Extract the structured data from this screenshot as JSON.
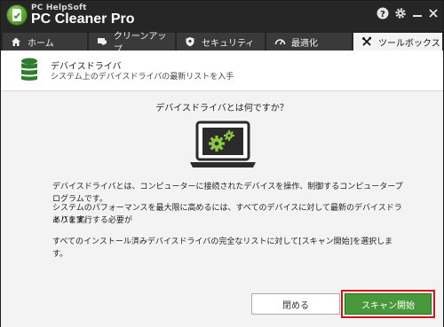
{
  "app": {
    "brand_small": "PC HelpSoft",
    "brand_big": "PC Cleaner Pro"
  },
  "titlebar_icons": [
    "help-icon",
    "gear-icon",
    "minimize-icon",
    "close-icon"
  ],
  "tabs": [
    {
      "label": "ホーム",
      "icon": "home-icon",
      "active": false
    },
    {
      "label": "クリーンアップ",
      "icon": "broom-icon",
      "active": false
    },
    {
      "label": "セキュリティ",
      "icon": "shield-icon",
      "active": false
    },
    {
      "label": "最適化",
      "icon": "gauge-icon",
      "active": false
    },
    {
      "label": "ツールボックス",
      "icon": "tools-icon",
      "active": true
    }
  ],
  "header": {
    "title": "デバイスドライバ",
    "subtitle": "システム上のデバイスドライバの最新リストを入手",
    "icon": "database-icon"
  },
  "content": {
    "question": "デバイスドライバとは何ですか？",
    "paragraphs": [
      "デバイスドライバとは、コンピューターに接続されたデバイスを操作、制御するコンピュータープログラムです。",
      "システムのパフォーマンスを最大限に高めるには、すべてのデバイスに対して最新のデバイスドライバを実行する必要が",
      "あります。",
      "すべてのインストール済みデバイスドライバの完全なリストに対して[スキャン開始]を選択します。"
    ]
  },
  "buttons": {
    "close": "閉める",
    "scan": "スキャン開始"
  },
  "colors": {
    "accent_green": "#47993a",
    "highlight_red": "#d21414",
    "titlebar": "#262626"
  }
}
